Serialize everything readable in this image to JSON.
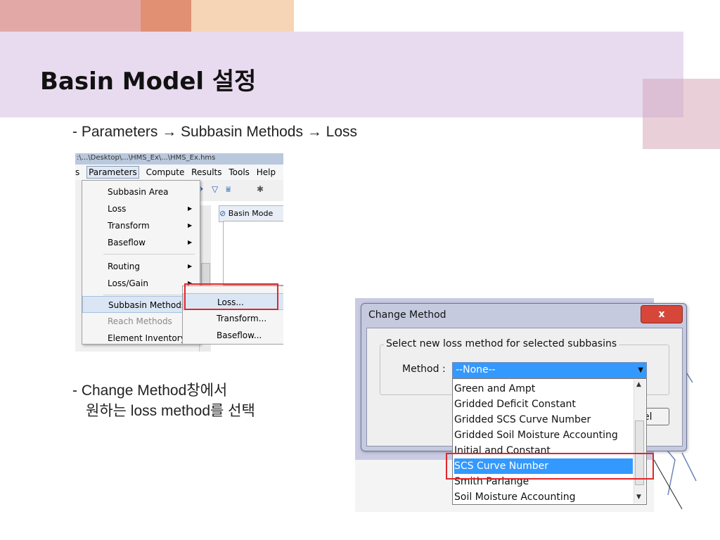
{
  "slide": {
    "title": "Basin Model 설정",
    "bullet1": "- Parameters → Subbasin Methods → Loss",
    "bullet2_line1": "- Change Method창에서",
    "bullet2_line2": "원하는 loss method를 선택"
  },
  "hms_menu": {
    "path_bar": ":\\...\\Desktop\\...\\HMS_Ex\\...\\HMS_Ex.hms",
    "menubar": [
      "s",
      "Parameters",
      "Compute",
      "Results",
      "Tools",
      "Help"
    ],
    "basin_tab": "Basin Mode",
    "items": [
      {
        "label": "Subbasin Area",
        "arrow": ""
      },
      {
        "label": "Loss",
        "arrow": "▶"
      },
      {
        "label": "Transform",
        "arrow": "▶"
      },
      {
        "label": "Baseflow",
        "arrow": "▶"
      },
      {
        "label": "Routing",
        "arrow": "▶"
      },
      {
        "label": "Loss/Gain",
        "arrow": "▶"
      },
      {
        "label": "Subbasin Methods",
        "arrow": "▶"
      },
      {
        "label": "Reach Methods",
        "arrow": "▶"
      },
      {
        "label": "Element Inventory",
        "arrow": ""
      }
    ],
    "submenu": [
      "Loss...",
      "Transform...",
      "Baseflow..."
    ]
  },
  "dialog": {
    "title": "Change Method",
    "close": "x",
    "group_label": "Select new loss method for selected subbasins",
    "method_label": "Method :",
    "selected_value": "--None--",
    "partial_button": "el",
    "options": [
      "Green and Ampt",
      "Gridded Deficit Constant",
      "Gridded SCS Curve Number",
      "Gridded Soil Moisture Accounting",
      "Initial and Constant",
      "SCS Curve Number",
      "Smith Parlange",
      "Soil Moisture Accounting"
    ],
    "highlighted_option": "SCS Curve Number"
  },
  "colors": {
    "highlight_box": "#e2262b",
    "selection_blue": "#3399ff",
    "title_band": "#e9dbef"
  }
}
